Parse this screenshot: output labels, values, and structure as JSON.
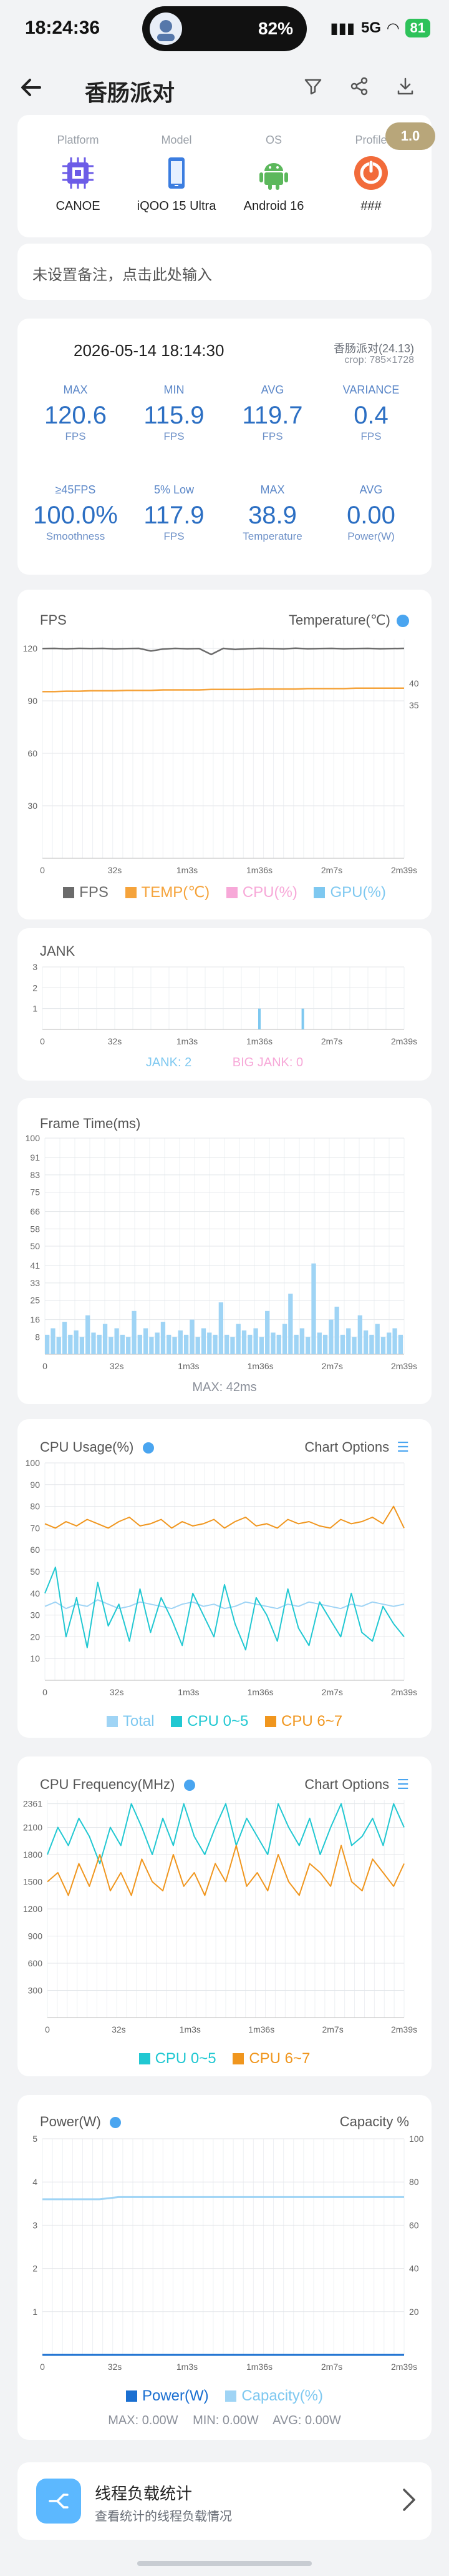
{
  "status_bar": {
    "time": "18:24:36",
    "notch_percent": "82%",
    "network": "5G",
    "battery": "81"
  },
  "app_bar": {
    "title": "香肠派对",
    "back_icon": "back-arrow-icon",
    "filter_icon": "filter-icon",
    "share_icon": "share-icon",
    "download_icon": "download-icon"
  },
  "device": {
    "columns": [
      {
        "label": "Platform",
        "value": "CANOE",
        "icon": "chip-icon"
      },
      {
        "label": "Model",
        "value": "iQOO 15 Ultra",
        "icon": "phone-icon"
      },
      {
        "label": "OS",
        "value": "Android 16",
        "icon": "android-icon"
      },
      {
        "label": "Profile",
        "value": "###",
        "icon": "profile-icon"
      }
    ],
    "version_badge": "1.0"
  },
  "note": {
    "placeholder": "未设置备注，点击此处输入"
  },
  "summary": {
    "datetime": "2026-05-14 18:14:30",
    "app_version": "香肠派对(24.13)",
    "crop": "crop: 785×1728",
    "row1": [
      {
        "label": "MAX",
        "value": "120.6",
        "unit": "FPS"
      },
      {
        "label": "MIN",
        "value": "115.9",
        "unit": "FPS"
      },
      {
        "label": "AVG",
        "value": "119.7",
        "unit": "FPS"
      },
      {
        "label": "VARIANCE",
        "value": "0.4",
        "unit": "FPS"
      }
    ],
    "row2": [
      {
        "label": "≥45FPS",
        "value": "100.0%",
        "unit": "Smoothness"
      },
      {
        "label": "5% Low",
        "value": "117.9",
        "unit": "FPS"
      },
      {
        "label": "MAX",
        "value": "38.9",
        "unit": "Temperature"
      },
      {
        "label": "AVG",
        "value": "0.00",
        "unit": "Power(W)"
      }
    ]
  },
  "fps_card": {
    "title": "FPS",
    "right": "Temperature(℃)",
    "legend": [
      "FPS",
      "TEMP(℃)",
      "CPU(%)",
      "GPU(%)"
    ]
  },
  "jank_card": {
    "title": "JANK",
    "jank_label": "JANK: 2",
    "big_jank_label": "BIG JANK: 0"
  },
  "frametime_card": {
    "title": "Frame Time(ms)",
    "max_label": "MAX: 42ms"
  },
  "cpu_usage_card": {
    "title": "CPU Usage(%)",
    "options": "Chart Options",
    "legend": [
      "Total",
      "CPU 0~5",
      "CPU 6~7"
    ]
  },
  "cpu_freq_card": {
    "title": "CPU Frequency(MHz)",
    "options": "Chart Options",
    "legend": [
      "CPU 0~5",
      "CPU 6~7"
    ]
  },
  "power_card": {
    "title": "Power(W)",
    "right": "Capacity %",
    "legend": [
      "Power(W)",
      "Capacity(%)"
    ],
    "max": "MAX: 0.00W",
    "min": "MIN: 0.00W",
    "avg": "AVG: 0.00W"
  },
  "thread_card": {
    "title": "线程负载统计",
    "subtitle": "查看统计的线程负载情况"
  },
  "colors": {
    "fps": "#6b6b6b",
    "temp": "#f5a33b",
    "cpu": "#f7a8d8",
    "gpu": "#7ec8f0",
    "cyan": "#21c8d2",
    "orange": "#f0961e",
    "blue": "#1a6fd1",
    "light_blue": "#9fd4f5",
    "jank": "#7ec8f0",
    "big_jank": "#f7a8d8"
  },
  "chart_data": [
    {
      "type": "line",
      "name": "FPS",
      "x_ticks": [
        "0",
        "32s",
        "1m3s",
        "1m36s",
        "2m7s",
        "2m39s"
      ],
      "y_ticks": [
        30,
        60,
        90,
        120
      ],
      "y_right_ticks": [
        35,
        40
      ],
      "ylim": [
        0,
        125
      ],
      "y_right_lim": [
        0,
        50
      ],
      "series": [
        {
          "name": "FPS",
          "values": [
            119.9,
            120.0,
            119.8,
            120.0,
            119.9,
            120.0,
            119.7,
            119.9,
            120.0,
            118.5,
            119.6,
            120.0,
            119.8,
            119.9,
            116.5,
            120.0,
            119.4,
            119.8,
            120.0,
            119.9,
            119.7,
            120.1,
            119.8,
            119.9,
            120.0,
            119.8,
            119.9,
            120.0,
            119.8,
            119.9,
            120.0
          ]
        },
        {
          "name": "TEMP(℃)",
          "values": [
            38.1,
            38.1,
            38.2,
            38.2,
            38.3,
            38.3,
            38.3,
            38.4,
            38.4,
            38.4,
            38.5,
            38.5,
            38.5,
            38.5,
            38.6,
            38.6,
            38.6,
            38.6,
            38.7,
            38.7,
            38.7,
            38.7,
            38.8,
            38.8,
            38.8,
            38.8,
            38.9,
            38.9,
            38.9,
            38.9,
            38.9
          ]
        }
      ],
      "grid": true,
      "legend_position": "bottom"
    },
    {
      "type": "bar",
      "name": "JANK",
      "x_ticks": [
        "0",
        "32s",
        "1m3s",
        "1m36s",
        "2m7s",
        "2m39s"
      ],
      "y_ticks": [
        1,
        2,
        3
      ],
      "ylim": [
        0,
        3
      ],
      "events": [
        {
          "x_frac": 0.6,
          "value": 1
        },
        {
          "x_frac": 0.72,
          "value": 1
        }
      ],
      "legend_position": "bottom"
    },
    {
      "type": "bar",
      "name": "Frame Time(ms)",
      "x_ticks": [
        "0",
        "32s",
        "1m3s",
        "1m36s",
        "2m7s",
        "2m39s"
      ],
      "y_ticks": [
        8,
        16,
        25,
        33,
        41,
        50,
        58,
        66,
        75,
        83,
        91,
        100
      ],
      "ylim": [
        0,
        100
      ],
      "values": [
        9,
        12,
        8,
        15,
        9,
        11,
        8,
        18,
        10,
        9,
        14,
        8,
        12,
        9,
        8,
        20,
        9,
        12,
        8,
        10,
        15,
        9,
        8,
        11,
        9,
        16,
        8,
        12,
        10,
        9,
        24,
        9,
        8,
        14,
        11,
        9,
        12,
        8,
        20,
        10,
        9,
        14,
        28,
        9,
        12,
        8,
        42,
        10,
        9,
        16,
        22,
        9,
        12,
        8,
        18,
        11,
        9,
        14,
        8,
        10,
        12,
        9
      ],
      "max_ms": 42
    },
    {
      "type": "line",
      "name": "CPU Usage(%)",
      "x_ticks": [
        "0",
        "32s",
        "1m3s",
        "1m36s",
        "2m7s",
        "2m39s"
      ],
      "y_ticks": [
        10,
        20,
        30,
        40,
        50,
        60,
        70,
        80,
        90,
        100
      ],
      "ylim": [
        0,
        100
      ],
      "series": [
        {
          "name": "Total",
          "values": [
            34,
            36,
            33,
            35,
            34,
            37,
            35,
            33,
            34,
            36,
            35,
            34,
            33,
            35,
            36,
            34,
            35,
            33,
            34,
            36,
            35,
            34,
            33,
            35,
            34,
            36,
            35,
            34,
            33,
            35,
            34,
            36,
            35,
            34,
            35
          ]
        },
        {
          "name": "CPU 0~5",
          "values": [
            40,
            52,
            20,
            38,
            15,
            45,
            25,
            35,
            18,
            42,
            22,
            38,
            28,
            16,
            40,
            30,
            20,
            44,
            26,
            14,
            38,
            30,
            18,
            42,
            24,
            16,
            36,
            28,
            20,
            40,
            22,
            18,
            34,
            26,
            20
          ]
        },
        {
          "name": "CPU 6~7",
          "values": [
            72,
            70,
            73,
            71,
            74,
            72,
            70,
            73,
            75,
            71,
            72,
            74,
            70,
            73,
            71,
            72,
            74,
            70,
            73,
            75,
            71,
            72,
            70,
            74,
            72,
            73,
            71,
            70,
            74,
            72,
            73,
            75,
            72,
            80,
            70
          ]
        }
      ],
      "legend_position": "bottom"
    },
    {
      "type": "line",
      "name": "CPU Frequency(MHz)",
      "x_ticks": [
        "0",
        "32s",
        "1m3s",
        "1m36s",
        "2m7s",
        "2m39s"
      ],
      "y_ticks": [
        300,
        600,
        900,
        1200,
        1500,
        1800,
        2100,
        2361
      ],
      "ylim": [
        0,
        2400
      ],
      "series": [
        {
          "name": "CPU 0~5",
          "values": [
            1800,
            2100,
            1900,
            2200,
            2000,
            1700,
            2100,
            1900,
            2361,
            2100,
            1800,
            2200,
            1900,
            2361,
            2000,
            1800,
            2100,
            2361,
            1900,
            2200,
            2000,
            1800,
            2361,
            2100,
            1900,
            2200,
            1800,
            2100,
            2361,
            1900,
            2000,
            2200,
            1900,
            2361,
            2100
          ]
        },
        {
          "name": "CPU 6~7",
          "values": [
            1500,
            1600,
            1350,
            1700,
            1450,
            1800,
            1400,
            1600,
            1350,
            1750,
            1500,
            1400,
            1800,
            1450,
            1600,
            1350,
            1700,
            1500,
            1900,
            1450,
            1600,
            1400,
            1800,
            1500,
            1350,
            1700,
            1600,
            1450,
            1900,
            1500,
            1400,
            1750,
            1600,
            1450,
            1700
          ]
        }
      ],
      "legend_position": "bottom"
    },
    {
      "type": "line",
      "name": "Power(W)",
      "x_ticks": [
        "0",
        "32s",
        "1m3s",
        "1m36s",
        "2m7s",
        "2m39s"
      ],
      "y_ticks": [
        1,
        2,
        3,
        4,
        5
      ],
      "y_right_ticks": [
        20,
        40,
        60,
        80,
        100
      ],
      "ylim": [
        0,
        5
      ],
      "y_right_lim": [
        0,
        100
      ],
      "series": [
        {
          "name": "Power(W)",
          "values": [
            0,
            0,
            0,
            0,
            0,
            0,
            0,
            0,
            0,
            0,
            0,
            0,
            0,
            0,
            0,
            0,
            0,
            0,
            0,
            0
          ]
        },
        {
          "name": "Capacity(%)",
          "values": [
            72,
            72,
            72,
            72,
            73,
            73,
            73,
            73,
            73,
            73,
            73,
            73,
            73,
            73,
            73,
            73,
            73,
            73,
            73,
            73
          ]
        }
      ],
      "legend_position": "bottom"
    }
  ]
}
